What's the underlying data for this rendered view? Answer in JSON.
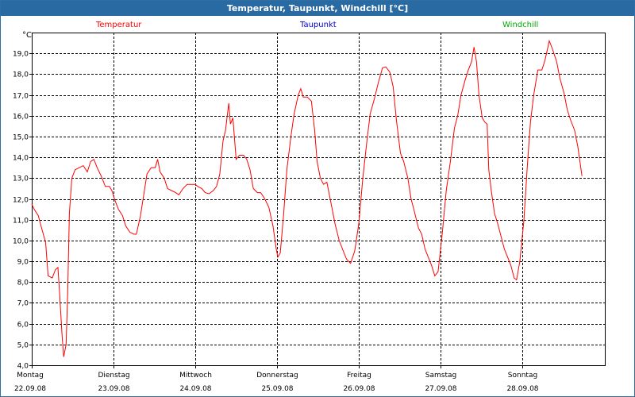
{
  "window": {
    "title": "Temperatur, Taupunkt, Windchill [°C]"
  },
  "legend": [
    {
      "label": "Temperatur",
      "color": "#ff0000"
    },
    {
      "label": "Taupunkt",
      "color": "#0000cc"
    },
    {
      "label": "Windchill",
      "color": "#00aa00"
    }
  ],
  "chart_data": {
    "type": "line",
    "unit": "°C",
    "ylim": [
      4.0,
      20.0
    ],
    "yticks": [
      "4,0",
      "5,0",
      "6,0",
      "7,0",
      "8,0",
      "9,0",
      "10,0",
      "11,0",
      "12,0",
      "13,0",
      "14,0",
      "15,0",
      "16,0",
      "17,0",
      "18,0",
      "19,0"
    ],
    "days": [
      {
        "name": "Montag",
        "date": "22.09.08"
      },
      {
        "name": "Dienstag",
        "date": "23.09.08"
      },
      {
        "name": "Mittwoch",
        "date": "24.09.08"
      },
      {
        "name": "Donnerstag",
        "date": "25.09.08"
      },
      {
        "name": "Freitag",
        "date": "26.09.08"
      },
      {
        "name": "Samstag",
        "date": "27.09.08"
      },
      {
        "name": "Sonntag",
        "date": "28.09.08"
      }
    ],
    "grid": true,
    "series": [
      {
        "name": "Temperatur",
        "color": "#ff0000",
        "points": [
          [
            0.0,
            11.75
          ],
          [
            0.03,
            11.5
          ],
          [
            0.08,
            11.2
          ],
          [
            0.12,
            10.6
          ],
          [
            0.17,
            9.9
          ],
          [
            0.2,
            8.3
          ],
          [
            0.25,
            8.2
          ],
          [
            0.29,
            8.6
          ],
          [
            0.32,
            8.7
          ],
          [
            0.34,
            7.5
          ],
          [
            0.37,
            5.5
          ],
          [
            0.39,
            4.4
          ],
          [
            0.42,
            5.0
          ],
          [
            0.44,
            7.5
          ],
          [
            0.46,
            11.3
          ],
          [
            0.49,
            13.0
          ],
          [
            0.53,
            13.4
          ],
          [
            0.58,
            13.5
          ],
          [
            0.63,
            13.6
          ],
          [
            0.68,
            13.3
          ],
          [
            0.72,
            13.8
          ],
          [
            0.76,
            13.9
          ],
          [
            0.8,
            13.5
          ],
          [
            0.85,
            13.1
          ],
          [
            0.9,
            12.6
          ],
          [
            0.95,
            12.6
          ],
          [
            0.98,
            12.4
          ],
          [
            1.02,
            11.9
          ],
          [
            1.06,
            11.5
          ],
          [
            1.11,
            11.2
          ],
          [
            1.15,
            10.7
          ],
          [
            1.2,
            10.4
          ],
          [
            1.25,
            10.3
          ],
          [
            1.28,
            10.3
          ],
          [
            1.33,
            11.2
          ],
          [
            1.37,
            12.2
          ],
          [
            1.41,
            13.2
          ],
          [
            1.46,
            13.5
          ],
          [
            1.51,
            13.5
          ],
          [
            1.54,
            13.9
          ],
          [
            1.57,
            13.3
          ],
          [
            1.62,
            13.0
          ],
          [
            1.66,
            12.5
          ],
          [
            1.71,
            12.4
          ],
          [
            1.76,
            12.3
          ],
          [
            1.8,
            12.2
          ],
          [
            1.85,
            12.5
          ],
          [
            1.9,
            12.7
          ],
          [
            1.95,
            12.7
          ],
          [
            2.0,
            12.7
          ],
          [
            2.03,
            12.6
          ],
          [
            2.08,
            12.5
          ],
          [
            2.12,
            12.3
          ],
          [
            2.17,
            12.25
          ],
          [
            2.22,
            12.4
          ],
          [
            2.26,
            12.6
          ],
          [
            2.3,
            13.2
          ],
          [
            2.34,
            14.8
          ],
          [
            2.37,
            15.3
          ],
          [
            2.41,
            16.6
          ],
          [
            2.43,
            15.6
          ],
          [
            2.46,
            15.9
          ],
          [
            2.5,
            13.9
          ],
          [
            2.54,
            14.1
          ],
          [
            2.59,
            14.1
          ],
          [
            2.63,
            13.9
          ],
          [
            2.67,
            13.4
          ],
          [
            2.71,
            12.5
          ],
          [
            2.76,
            12.3
          ],
          [
            2.8,
            12.3
          ],
          [
            2.85,
            12.0
          ],
          [
            2.9,
            11.6
          ],
          [
            2.95,
            10.7
          ],
          [
            2.99,
            9.6
          ],
          [
            3.01,
            9.2
          ],
          [
            3.04,
            9.4
          ],
          [
            3.08,
            11.2
          ],
          [
            3.12,
            13.4
          ],
          [
            3.17,
            15.0
          ],
          [
            3.21,
            16.1
          ],
          [
            3.26,
            17.0
          ],
          [
            3.29,
            17.3
          ],
          [
            3.32,
            16.9
          ],
          [
            3.37,
            16.9
          ],
          [
            3.42,
            16.7
          ],
          [
            3.46,
            15.3
          ],
          [
            3.49,
            13.8
          ],
          [
            3.53,
            13.0
          ],
          [
            3.57,
            12.7
          ],
          [
            3.61,
            12.8
          ],
          [
            3.66,
            11.8
          ],
          [
            3.71,
            10.8
          ],
          [
            3.76,
            10.0
          ],
          [
            3.81,
            9.5
          ],
          [
            3.85,
            9.1
          ],
          [
            3.9,
            8.9
          ],
          [
            3.95,
            9.5
          ],
          [
            4.0,
            10.8
          ],
          [
            4.05,
            13.0
          ],
          [
            4.1,
            14.8
          ],
          [
            4.14,
            16.1
          ],
          [
            4.19,
            16.8
          ],
          [
            4.24,
            17.6
          ],
          [
            4.29,
            18.3
          ],
          [
            4.33,
            18.35
          ],
          [
            4.38,
            18.1
          ],
          [
            4.42,
            17.4
          ],
          [
            4.46,
            15.8
          ],
          [
            4.51,
            14.2
          ],
          [
            4.55,
            13.8
          ],
          [
            4.6,
            13.0
          ],
          [
            4.64,
            12.0
          ],
          [
            4.68,
            11.4
          ],
          [
            4.73,
            10.6
          ],
          [
            4.77,
            10.3
          ],
          [
            4.81,
            9.6
          ],
          [
            4.85,
            9.2
          ],
          [
            4.89,
            8.8
          ],
          [
            4.93,
            8.3
          ],
          [
            4.97,
            8.5
          ],
          [
            5.02,
            10.3
          ],
          [
            5.07,
            12.4
          ],
          [
            5.12,
            13.8
          ],
          [
            5.17,
            15.4
          ],
          [
            5.21,
            16.0
          ],
          [
            5.25,
            17.0
          ],
          [
            5.3,
            17.7
          ],
          [
            5.34,
            18.2
          ],
          [
            5.38,
            18.6
          ],
          [
            5.41,
            19.3
          ],
          [
            5.44,
            18.6
          ],
          [
            5.47,
            17.0
          ],
          [
            5.51,
            15.9
          ],
          [
            5.54,
            15.7
          ],
          [
            5.57,
            15.6
          ],
          [
            5.59,
            13.4
          ],
          [
            5.62,
            12.4
          ],
          [
            5.66,
            11.3
          ],
          [
            5.7,
            10.8
          ],
          [
            5.74,
            10.2
          ],
          [
            5.78,
            9.6
          ],
          [
            5.82,
            9.2
          ],
          [
            5.86,
            8.8
          ],
          [
            5.9,
            8.2
          ],
          [
            5.93,
            8.1
          ],
          [
            5.97,
            9.0
          ],
          [
            6.02,
            11.0
          ],
          [
            6.06,
            13.5
          ],
          [
            6.1,
            15.7
          ],
          [
            6.14,
            17.0
          ],
          [
            6.19,
            18.2
          ],
          [
            6.24,
            18.2
          ],
          [
            6.28,
            18.7
          ],
          [
            6.33,
            19.6
          ],
          [
            6.37,
            19.2
          ],
          [
            6.42,
            18.6
          ],
          [
            6.46,
            17.8
          ],
          [
            6.51,
            17.1
          ],
          [
            6.55,
            16.3
          ],
          [
            6.59,
            15.8
          ],
          [
            6.64,
            15.3
          ],
          [
            6.68,
            14.5
          ],
          [
            6.73,
            13.1
          ]
        ]
      }
    ]
  }
}
